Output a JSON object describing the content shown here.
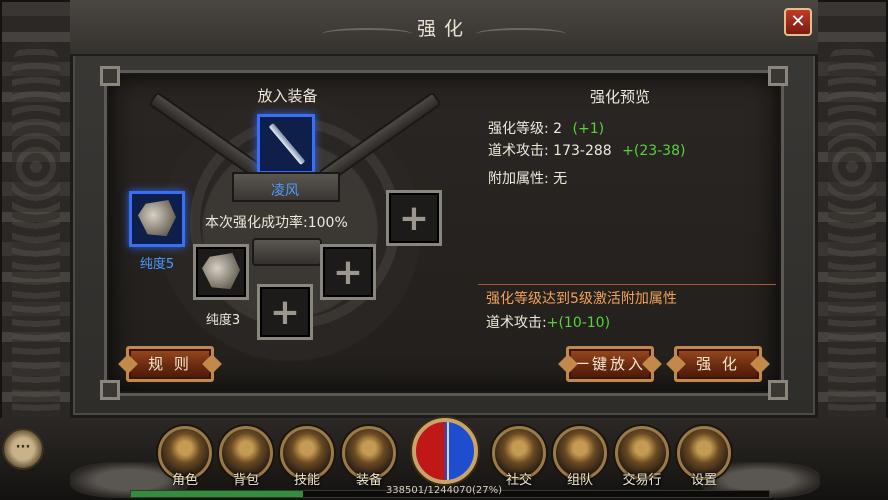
{
  "window": {
    "title": "强化",
    "close_icon": "close-icon"
  },
  "left": {
    "section_title": "放入装备",
    "main_item": {
      "name": "凌风",
      "icon": "sword-icon"
    },
    "success_rate_label": "本次强化成功率:100%",
    "material_1": {
      "label": "纯度5",
      "icon": "ore-icon"
    },
    "material_2": {
      "label": "纯度3",
      "icon": "ore-icon"
    },
    "empty_slot_icon": "plus-icon"
  },
  "preview": {
    "title": "强化预览",
    "level_label": "强化等级: 2",
    "level_bonus": "(+1)",
    "attack_label": "道术攻击: 173-288",
    "attack_bonus": "+(23-38)",
    "extra_label": "附加属性: 无",
    "notice": "强化等级达到5级激活附加属性",
    "notice_attack_label": "道术攻击:",
    "notice_attack_value": "+(10-10)"
  },
  "buttons": {
    "rules": "规 则",
    "one_click": "一键放入",
    "enhance": "强 化"
  },
  "menu": [
    {
      "label": "角色",
      "icon": "character-icon"
    },
    {
      "label": "背包",
      "icon": "bag-icon"
    },
    {
      "label": "技能",
      "icon": "skill-book-icon"
    },
    {
      "label": "装备",
      "icon": "equipment-icon"
    },
    {
      "label": "社交",
      "icon": "social-icon"
    },
    {
      "label": "组队",
      "icon": "team-icon"
    },
    {
      "label": "交易行",
      "icon": "trade-icon"
    },
    {
      "label": "设置",
      "icon": "gear-icon"
    }
  ],
  "chat": {
    "label": "···",
    "icon": "chat-icon"
  },
  "exp": {
    "text": "338501/1244070(27%)",
    "progress": 0.27
  },
  "colors": {
    "bonus_green": "#58d23a",
    "notice_orange": "#f0a25a",
    "slot_blue": "#3a6ff0"
  }
}
